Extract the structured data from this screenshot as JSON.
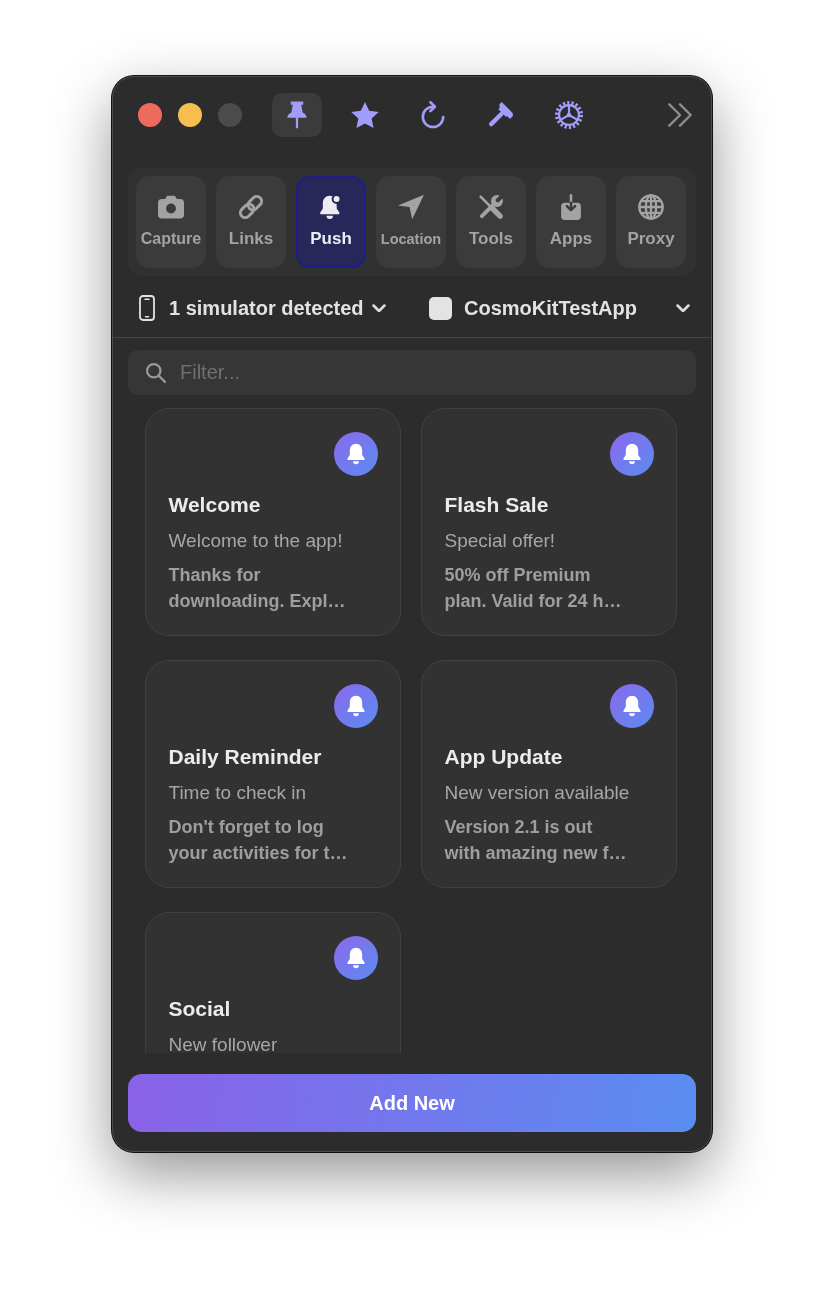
{
  "window": {
    "controls": [
      {
        "kind": "close",
        "disabled": false
      },
      {
        "kind": "minimize",
        "disabled": false
      },
      {
        "kind": "zoom",
        "disabled": true
      }
    ]
  },
  "toolbar": [
    {
      "kind": "pin",
      "selected": true
    },
    {
      "kind": "star",
      "selected": false
    },
    {
      "kind": "refresh",
      "selected": false
    },
    {
      "kind": "hammer",
      "selected": false
    },
    {
      "kind": "gear",
      "selected": false
    }
  ],
  "tabs": [
    {
      "kind": "camera",
      "label": "Capture",
      "selected": false
    },
    {
      "kind": "link",
      "label": "Links",
      "selected": false
    },
    {
      "kind": "bell",
      "label": "Push",
      "selected": true
    },
    {
      "kind": "location",
      "label": "Location",
      "selected": false
    },
    {
      "kind": "tools",
      "label": "Tools",
      "selected": false
    },
    {
      "kind": "download",
      "label": "Apps",
      "selected": false
    },
    {
      "kind": "globe",
      "label": "Proxy",
      "selected": false
    }
  ],
  "device_picker": {
    "label": "1 simulator detected"
  },
  "app_picker": {
    "label": "CosmoKitTestApp"
  },
  "filter": {
    "placeholder": "Filter..."
  },
  "notifications": [
    {
      "title": "Welcome",
      "subtitle": "Welcome to the app!",
      "body": "Thanks for downloading. Expl…"
    },
    {
      "title": "Flash Sale",
      "subtitle": "Special offer!",
      "body": "50% off Premium plan. Valid for 24 h…"
    },
    {
      "title": "Daily Reminder",
      "subtitle": "Time to check in",
      "body": "Don't forget to log your activities for t…"
    },
    {
      "title": "App Update",
      "subtitle": "New version available",
      "body": "Version 2.1 is out with amazing new f…"
    },
    {
      "title": "Social",
      "subtitle": "New follower"
    }
  ],
  "add_button": {
    "label": "Add New"
  }
}
